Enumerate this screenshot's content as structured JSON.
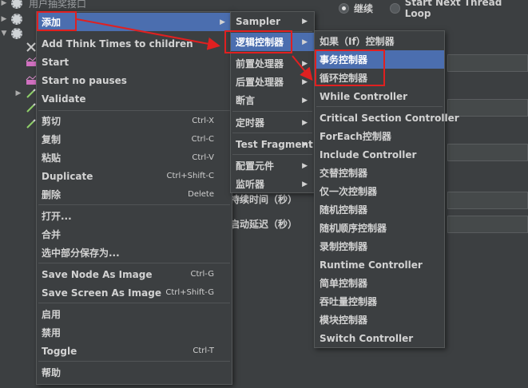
{
  "tree": {
    "top_item": "用户抽奖接口"
  },
  "background": {
    "radio_continue": "继续",
    "radio_next_loop": "Start Next Thread Loop",
    "label_duration": "持续时间（秒）",
    "label_startup_delay": "启动延迟（秒）"
  },
  "context_menu": {
    "items": [
      {
        "label": "添加",
        "arrow": "▶"
      },
      {
        "label": "Add Think Times to children"
      },
      {
        "label": "Start"
      },
      {
        "label": "Start no pauses"
      },
      {
        "label": "Validate"
      },
      {
        "label": "剪切",
        "shortcut": "Ctrl-X"
      },
      {
        "label": "复制",
        "shortcut": "Ctrl-C"
      },
      {
        "label": "粘贴",
        "shortcut": "Ctrl-V"
      },
      {
        "label": "Duplicate",
        "shortcut": "Ctrl+Shift-C"
      },
      {
        "label": "删除",
        "shortcut": "Delete"
      },
      {
        "label": "打开..."
      },
      {
        "label": "合并"
      },
      {
        "label": "选中部分保存为..."
      },
      {
        "label": "Save Node As Image",
        "shortcut": "Ctrl-G"
      },
      {
        "label": "Save Screen As Image",
        "shortcut": "Ctrl+Shift-G"
      },
      {
        "label": "启用"
      },
      {
        "label": "禁用"
      },
      {
        "label": "Toggle",
        "shortcut": "Ctrl-T"
      },
      {
        "label": "帮助"
      }
    ]
  },
  "add_submenu": {
    "items": [
      {
        "label": "Sampler",
        "arrow": "▶"
      },
      {
        "label": "逻辑控制器",
        "arrow": "▶"
      },
      {
        "label": "前置处理器",
        "arrow": "▶"
      },
      {
        "label": "后置处理器",
        "arrow": "▶"
      },
      {
        "label": "断言",
        "arrow": "▶"
      },
      {
        "label": "定时器",
        "arrow": "▶"
      },
      {
        "label": "Test Fragment",
        "arrow": "▶"
      },
      {
        "label": "配置元件",
        "arrow": "▶"
      },
      {
        "label": "监听器",
        "arrow": "▶"
      }
    ]
  },
  "logic_submenu": {
    "items": [
      {
        "label": "如果（If）控制器"
      },
      {
        "label": "事务控制器"
      },
      {
        "label": "循环控制器"
      },
      {
        "label": "While Controller"
      },
      {
        "label": "Critical Section Controller"
      },
      {
        "label": "ForEach控制器"
      },
      {
        "label": "Include Controller"
      },
      {
        "label": "交替控制器"
      },
      {
        "label": "仅一次控制器"
      },
      {
        "label": "随机控制器"
      },
      {
        "label": "随机顺序控制器"
      },
      {
        "label": "录制控制器"
      },
      {
        "label": "Runtime Controller"
      },
      {
        "label": "简单控制器"
      },
      {
        "label": "吞吐量控制器"
      },
      {
        "label": "模块控制器"
      },
      {
        "label": "Switch Controller"
      }
    ]
  },
  "colors": {
    "highlight": "#4b6eaf",
    "annotation": "#e02020",
    "panel": "#3c3f41"
  }
}
